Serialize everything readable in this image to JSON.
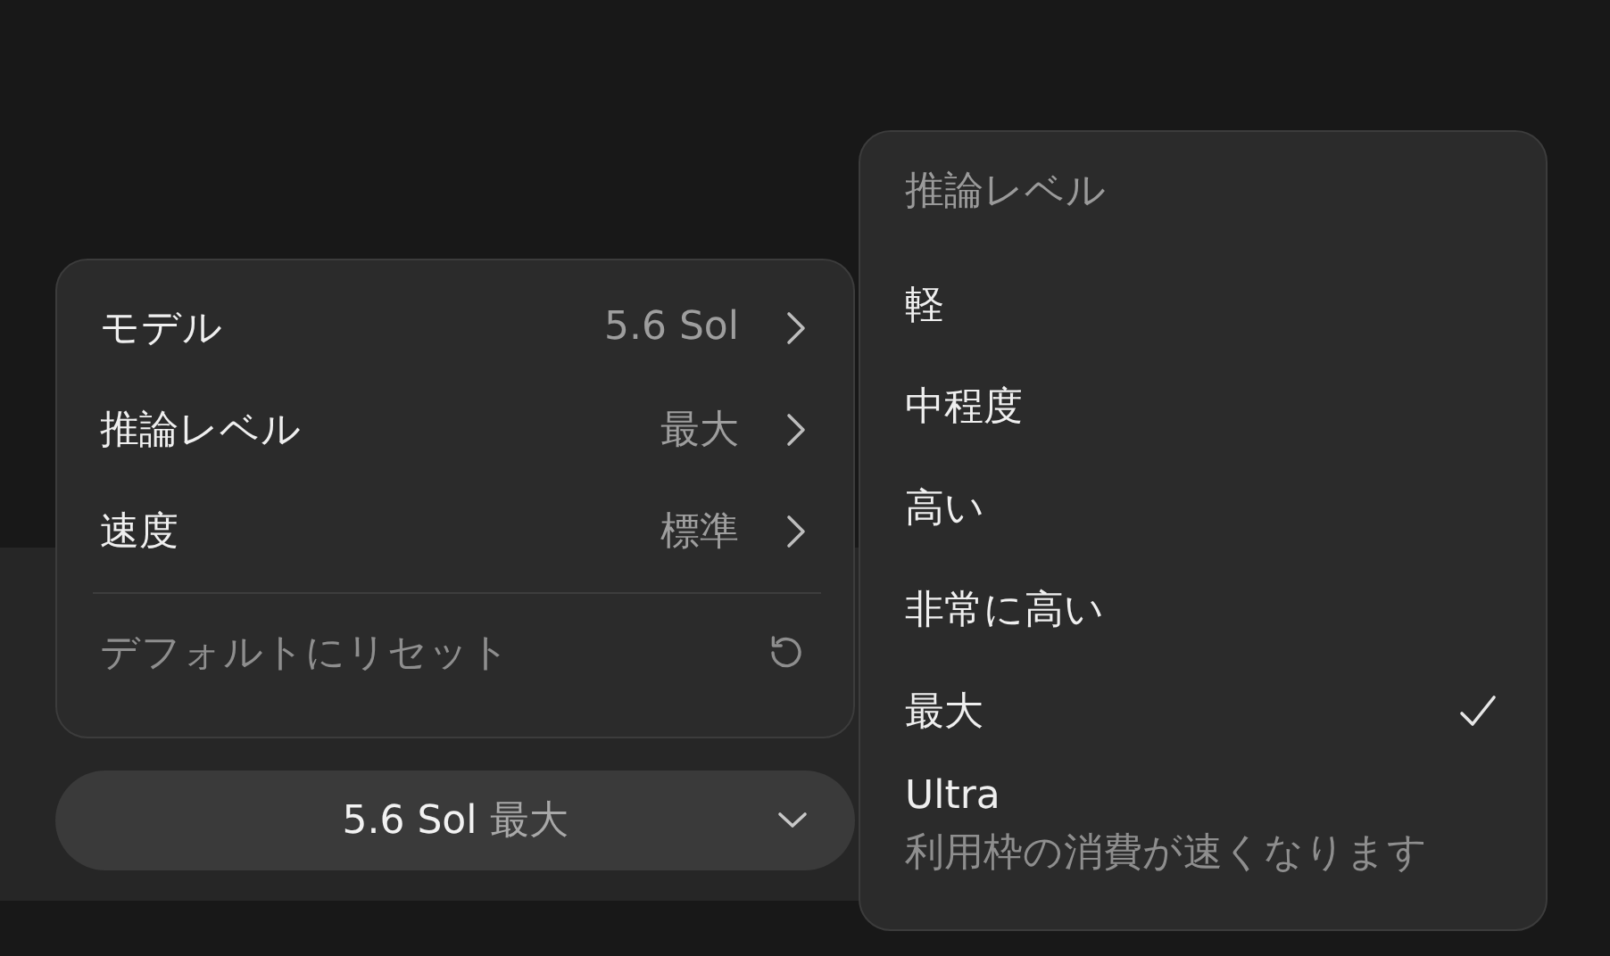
{
  "settings_menu": {
    "items": [
      {
        "label": "モデル",
        "value": "5.6 Sol"
      },
      {
        "label": "推論レベル",
        "value": "最大"
      },
      {
        "label": "速度",
        "value": "標準"
      }
    ],
    "reset": {
      "label": "デフォルトにリセット",
      "disabled": true
    }
  },
  "model_button": {
    "model": "5.6 Sol",
    "effort": "最大"
  },
  "reasoning_menu": {
    "title": "推論レベル",
    "options": [
      {
        "label": "軽",
        "selected": false
      },
      {
        "label": "中程度",
        "selected": false
      },
      {
        "label": "高い",
        "selected": false
      },
      {
        "label": "非常に高い",
        "selected": false
      },
      {
        "label": "最大",
        "selected": true
      },
      {
        "label": "Ultra",
        "description": "利用枠の消費が速くなります",
        "selected": false
      }
    ]
  }
}
